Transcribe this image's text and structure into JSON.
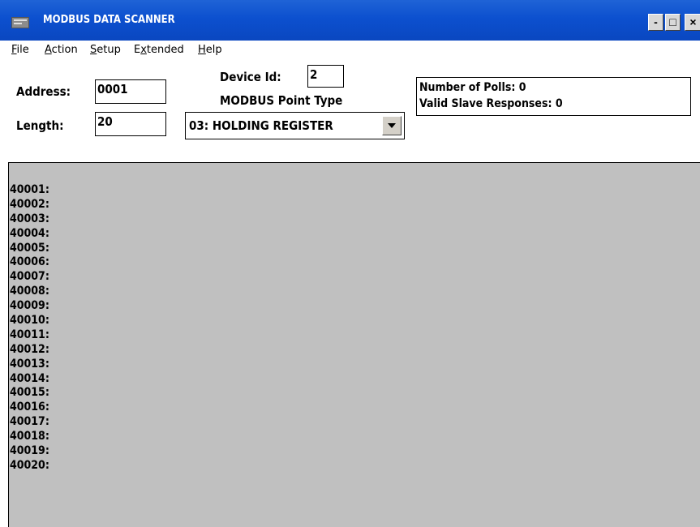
{
  "window": {
    "title": "MODBUS DATA SCANNER",
    "controls": {
      "minimize": "-",
      "maximize": "□",
      "close": "×"
    }
  },
  "menu": [
    {
      "accel": "F",
      "rest": "ile"
    },
    {
      "accel": "A",
      "rest": "ction"
    },
    {
      "accel": "S",
      "rest": "etup"
    },
    {
      "pre": "E",
      "accel": "x",
      "rest": "tended"
    },
    {
      "accel": "H",
      "rest": "elp"
    }
  ],
  "form": {
    "address_label": "Address:",
    "address_value": "0001",
    "length_label": "Length:",
    "length_value": "20",
    "device_id_label": "Device Id:",
    "device_id_value": "2",
    "point_type_label": "MODBUS Point Type",
    "point_type_selected": "03: HOLDING REGISTER"
  },
  "status": {
    "polls": "Number of Polls: 0",
    "valid_responses": "Valid Slave Responses: 0"
  },
  "registers": [
    "40001:",
    "40002:",
    "40003:",
    "40004:",
    "40005:",
    "40006:",
    "40007:",
    "40008:",
    "40009:",
    "40010:",
    "40011:",
    "40012:",
    "40013:",
    "40014:",
    "40015:",
    "40016:",
    "40017:",
    "40018:",
    "40019:",
    "40020:"
  ],
  "icons": {
    "app": "app-icon",
    "dropdown": "chevron-down-icon"
  },
  "colors": {
    "titlebar": "#0c50cf",
    "panel": "#c0c0c0"
  }
}
